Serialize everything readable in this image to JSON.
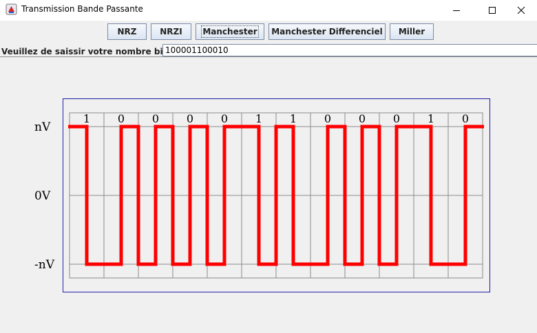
{
  "window": {
    "title": "Transmission Bande Passante"
  },
  "toolbar": {
    "buttons": [
      {
        "label": "NRZ"
      },
      {
        "label": "NRZI"
      },
      {
        "label": "Manchester"
      },
      {
        "label": "Manchester Differenciel"
      },
      {
        "label": "Miller"
      }
    ],
    "focused_button": "Manchester"
  },
  "input": {
    "prompt": "Veuillez de saissir votre nombre binaire :",
    "value": "100001100010"
  },
  "chart_data": {
    "type": "line",
    "encoding": "Manchester",
    "bits": [
      "1",
      "0",
      "0",
      "0",
      "0",
      "1",
      "1",
      "0",
      "0",
      "0",
      "1",
      "0"
    ],
    "y_labels": [
      "nV",
      "0V",
      "-nV"
    ],
    "levels": [
      1,
      0,
      -1
    ],
    "signal_levels": [
      1,
      -1,
      -1,
      1,
      -1,
      1,
      -1,
      1,
      -1,
      1,
      1,
      -1,
      1,
      -1,
      -1,
      1,
      -1,
      1,
      -1,
      1,
      1,
      -1,
      -1,
      1
    ],
    "colors": {
      "signal": "#ff0000",
      "grid": "#8a8a8a",
      "frame": "#1a1aa6"
    }
  }
}
